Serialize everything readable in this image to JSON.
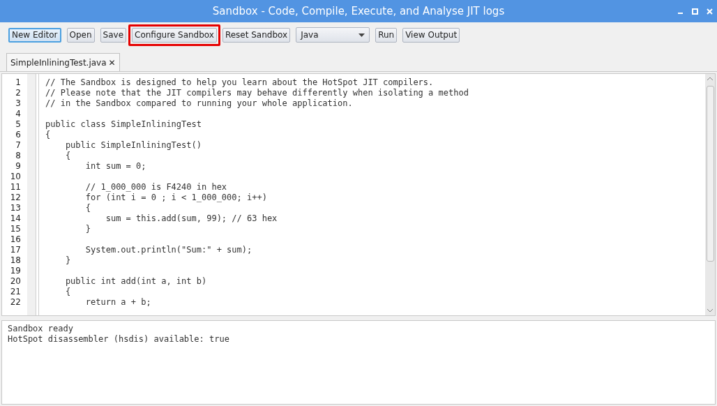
{
  "window": {
    "title": "Sandbox - Code, Compile, Execute, and Analyse JIT logs"
  },
  "toolbar": [
    {
      "kind": "button",
      "label": "New Editor",
      "focused": true,
      "highlighted": false
    },
    {
      "kind": "button",
      "label": "Open",
      "focused": false,
      "highlighted": false
    },
    {
      "kind": "button",
      "label": "Save",
      "focused": false,
      "highlighted": false
    },
    {
      "kind": "button",
      "label": "Configure Sandbox",
      "focused": false,
      "highlighted": true
    },
    {
      "kind": "button",
      "label": "Reset Sandbox",
      "focused": false,
      "highlighted": false
    },
    {
      "kind": "dropdown",
      "label": "Java"
    },
    {
      "kind": "button",
      "label": "Run",
      "focused": false,
      "highlighted": false
    },
    {
      "kind": "button",
      "label": "View Output",
      "focused": false,
      "highlighted": false
    }
  ],
  "tabs": [
    {
      "label": "SimpleInliningTest.java",
      "close": "✕",
      "selected": true
    }
  ],
  "editor": {
    "lines": [
      {
        "number": "1",
        "code": "// The Sandbox is designed to help you learn about the HotSpot JIT compilers."
      },
      {
        "number": "2",
        "code": "// Please note that the JIT compilers may behave differently when isolating a method"
      },
      {
        "number": "3",
        "code": "// in the Sandbox compared to running your whole application."
      },
      {
        "number": "4"
      },
      {
        "number": "5",
        "code": "public class SimpleInliningTest"
      },
      {
        "number": "6",
        "code": "{"
      },
      {
        "number": "7",
        "code": "    public SimpleInliningTest()"
      },
      {
        "number": "8",
        "code": "    {"
      },
      {
        "number": "9",
        "code": "        int sum = 0;"
      },
      {
        "number": "10"
      },
      {
        "number": "11",
        "code": "        // 1_000_000 is F4240 in hex"
      },
      {
        "number": "12",
        "code": "        for (int i = 0 ; i < 1_000_000; i++)"
      },
      {
        "number": "13",
        "code": "        {"
      },
      {
        "number": "14",
        "code": "            sum = this.add(sum, 99); // 63 hex"
      },
      {
        "number": "15",
        "code": "        }"
      },
      {
        "number": "16"
      },
      {
        "number": "17",
        "code": "        System.out.println(\"Sum:\" + sum);"
      },
      {
        "number": "18",
        "code": "    }"
      },
      {
        "number": "19"
      },
      {
        "number": "20",
        "code": "    public int add(int a, int b)"
      },
      {
        "number": "21",
        "code": "    {"
      },
      {
        "number": "22",
        "code": "        return a + b;"
      }
    ]
  },
  "console": {
    "lines": [
      "Sandbox ready",
      "HotSpot disassembler (hsdis) available: true"
    ]
  }
}
